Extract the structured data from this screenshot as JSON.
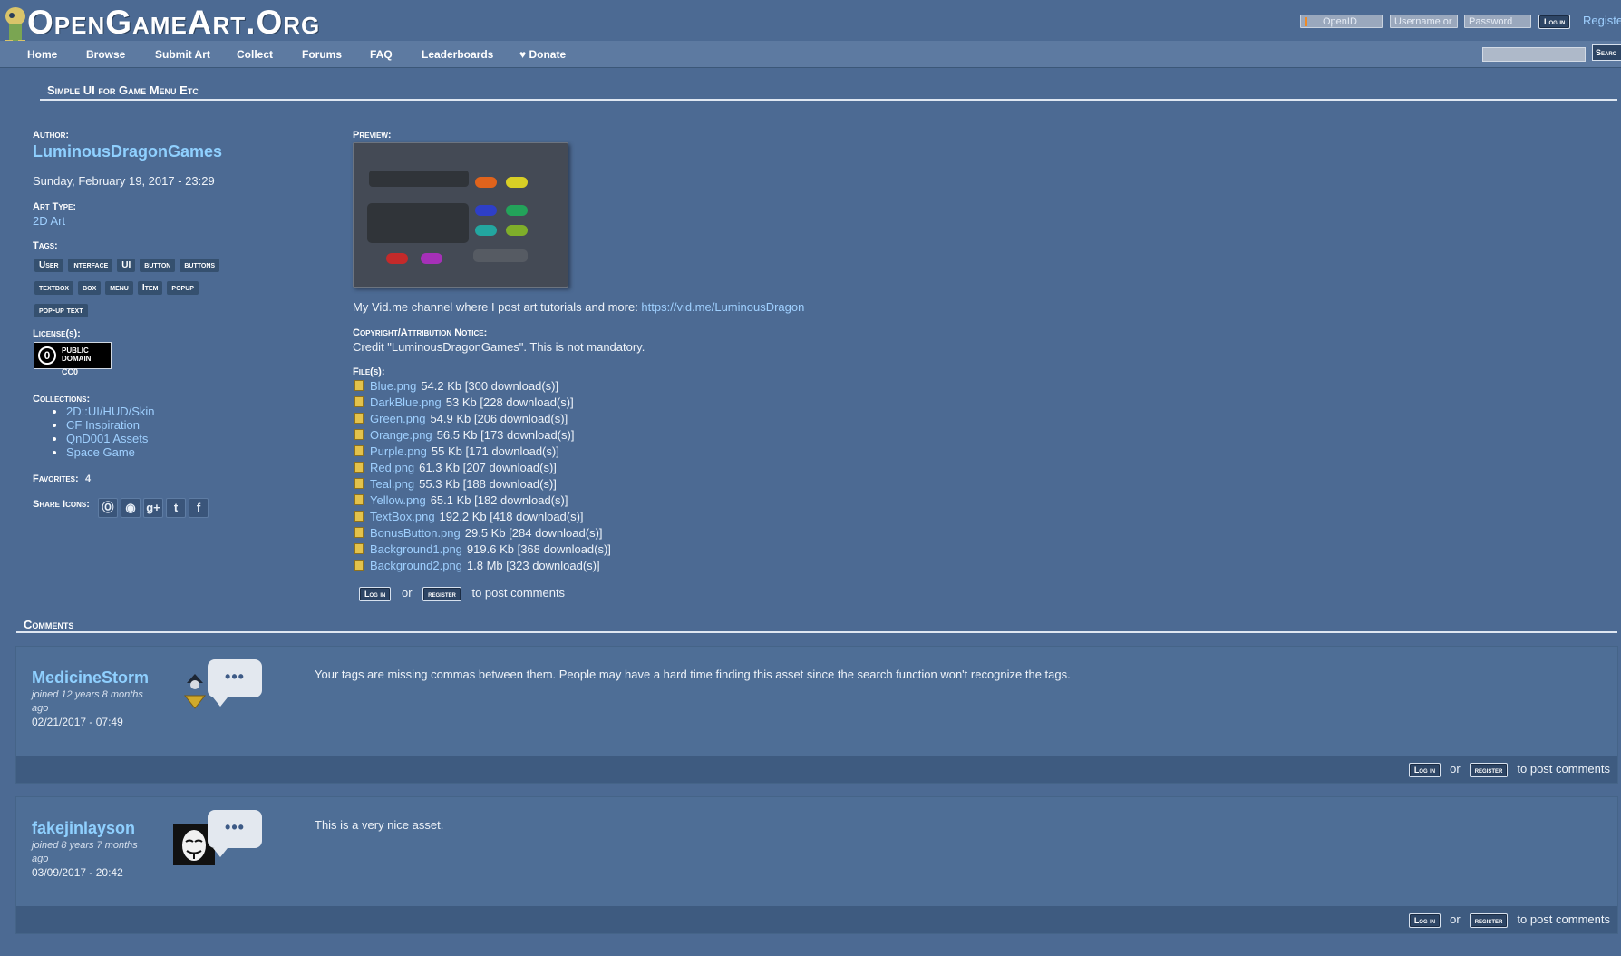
{
  "header": {
    "site_title": "OpenGameArt.Org",
    "openid_placeholder": "OpenID",
    "username_placeholder": "Username or",
    "password_placeholder": "Password",
    "login_label": "Log in",
    "register_label": "Registe"
  },
  "nav": {
    "items": [
      "Home",
      "Browse",
      "Submit Art",
      "Collect",
      "Forums",
      "FAQ",
      "Leaderboards",
      "Donate"
    ],
    "search_label": "Searc"
  },
  "page": {
    "title": "Simple UI for Game Menu Etc"
  },
  "sidebar": {
    "author_label": "Author:",
    "author_name": "LuminousDragonGames",
    "date": "Sunday, February 19, 2017 - 23:29",
    "art_type_label": "Art Type:",
    "art_type": "2D Art",
    "tags_label": "Tags:",
    "tags": [
      "User",
      "interface",
      "UI",
      "button",
      "buttons",
      "textbox",
      "box",
      "menu",
      "Item",
      "popup",
      "pop-up text"
    ],
    "license_label": "License(s):",
    "license_badge_text": "PUBLIC DOMAIN",
    "license_name": "CC0",
    "collections_label": "Collections:",
    "collections": [
      "2D::UI/HUD/Skin",
      "CF Inspiration",
      "QnD001 Assets",
      "Space Game"
    ],
    "favorites_label": "Favorites:",
    "favorites_count": "4",
    "share_label": "Share Icons:"
  },
  "main": {
    "preview_label": "Preview:",
    "vid_text": "My Vid.me channel where I post art tutorials and more: ",
    "vid_link": "https://vid.me/LuminousDragon",
    "copyright_label": "Copyright/Attribution Notice:",
    "copyright_text": "Credit \"LuminousDragonGames\". This is not mandatory.",
    "files_label": "File(s):",
    "files": [
      {
        "name": "Blue.png",
        "meta": "54.2 Kb [300 download(s)]"
      },
      {
        "name": "DarkBlue.png",
        "meta": "53 Kb [228 download(s)]"
      },
      {
        "name": "Green.png",
        "meta": "54.9 Kb [206 download(s)]"
      },
      {
        "name": "Orange.png",
        "meta": "56.5 Kb [173 download(s)]"
      },
      {
        "name": "Purple.png",
        "meta": "55 Kb [171 download(s)]"
      },
      {
        "name": "Red.png",
        "meta": "61.3 Kb [207 download(s)]"
      },
      {
        "name": "Teal.png",
        "meta": "55.3 Kb [188 download(s)]"
      },
      {
        "name": "Yellow.png",
        "meta": "65.1 Kb [182 download(s)]"
      },
      {
        "name": "TextBox.png",
        "meta": "192.2 Kb [418 download(s)]"
      },
      {
        "name": "BonusButton.png",
        "meta": "29.5 Kb [284 download(s)]"
      },
      {
        "name": "Background1.png",
        "meta": "919.6 Kb [368 download(s)]"
      },
      {
        "name": "Background2.png",
        "meta": "1.8 Mb [323 download(s)]"
      }
    ],
    "post": {
      "login": "Log in",
      "or": "or",
      "register": "register",
      "suffix": "to post comments"
    }
  },
  "comments": {
    "title": "Comments",
    "items": [
      {
        "user": "MedicineStorm",
        "joined": "joined 12 years 8 months ago",
        "date": "02/21/2017 - 07:49",
        "text": "Your tags are missing commas between them. People may have a hard time finding this asset since the search function won't recognize the tags."
      },
      {
        "user": "fakejinlayson",
        "joined": "joined 8 years 7 months ago",
        "date": "03/09/2017 - 20:42",
        "text": "This is a very nice asset."
      }
    ],
    "bubble_dots": "•••",
    "post": {
      "login": "Log in",
      "or": "or",
      "register": "register",
      "suffix": "to post comments"
    }
  },
  "colors": {
    "page_bg": "#4c6a93",
    "nav_bg": "#5d7aa1",
    "link": "#9fd0ff",
    "tag_bg": "#35506f"
  },
  "icons": {
    "share": [
      "stumbleupon-icon",
      "reddit-icon",
      "google-plus-icon",
      "twitter-icon",
      "facebook-icon"
    ],
    "share_glyphs": [
      "Ⓞ",
      "◉",
      "g+",
      "t",
      "f"
    ],
    "donate_glyph": "♥"
  }
}
